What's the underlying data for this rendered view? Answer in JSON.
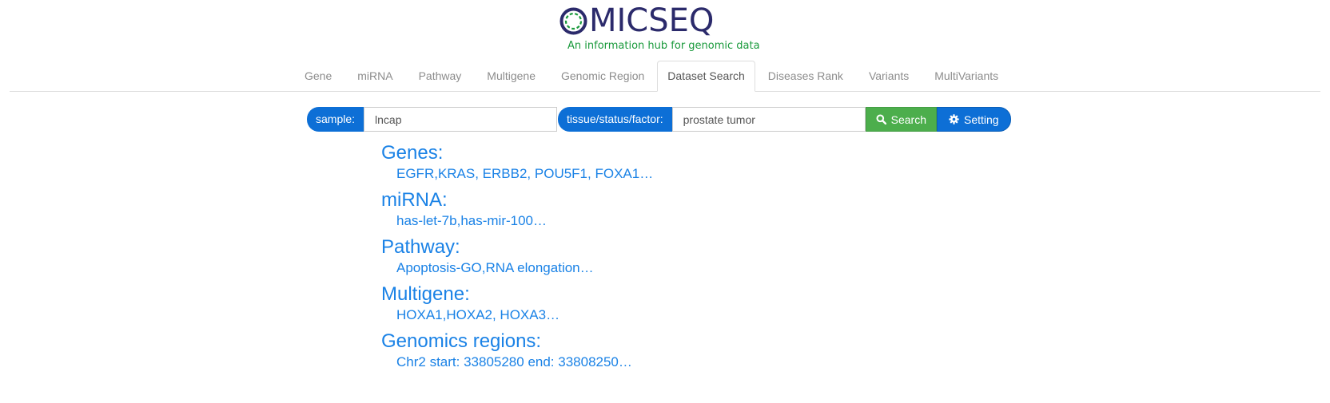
{
  "logo": {
    "name": "OMICSEQ",
    "tagline": "An information hub for genomic data",
    "colors": {
      "brand": "#2b2a6b",
      "tagline": "#1a9a3c",
      "ring_accent": "#1a9a3c"
    }
  },
  "tabs": [
    {
      "label": "Gene",
      "active": false
    },
    {
      "label": "miRNA",
      "active": false
    },
    {
      "label": "Pathway",
      "active": false
    },
    {
      "label": "Multigene",
      "active": false
    },
    {
      "label": "Genomic Region",
      "active": false
    },
    {
      "label": "Dataset Search",
      "active": true
    },
    {
      "label": "Diseases Rank",
      "active": false
    },
    {
      "label": "Variants",
      "active": false
    },
    {
      "label": "MultiVariants",
      "active": false
    }
  ],
  "search": {
    "sample_label": "sample:",
    "sample_value": "lncap",
    "tissue_label": "tissue/status/factor:",
    "tissue_value": "prostate tumor",
    "search_button": "Search",
    "search_icon": "search-icon",
    "setting_button": "Setting",
    "setting_icon": "gear-icon",
    "colors": {
      "addon": "#0d6fd6",
      "search": "#4cae4c",
      "setting": "#0d6fd6"
    }
  },
  "examples": [
    {
      "heading": "Genes:",
      "value": "EGFR,KRAS, ERBB2, POU5F1, FOXA1…"
    },
    {
      "heading": "miRNA:",
      "value": "has-let-7b,has-mir-100…"
    },
    {
      "heading": "Pathway:",
      "value": "Apoptosis-GO,RNA elongation…"
    },
    {
      "heading": "Multigene:",
      "value": "HOXA1,HOXA2, HOXA3…"
    },
    {
      "heading": "Genomics regions:",
      "value": "Chr2 start: 33805280 end: 33808250…"
    }
  ],
  "colors": {
    "link": "#1a82e6"
  }
}
